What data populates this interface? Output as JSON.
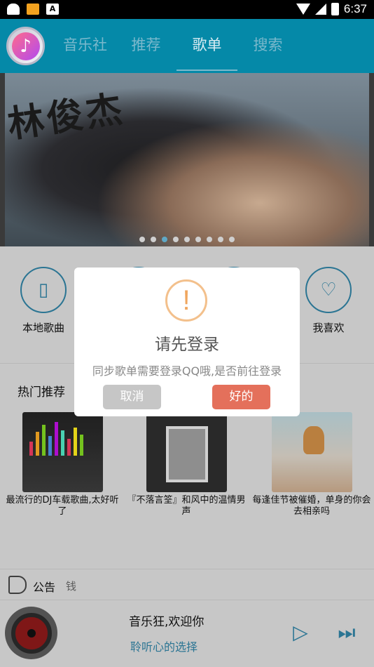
{
  "status_bar": {
    "time": "6:37",
    "icons": [
      "android-icon",
      "app-notification-icon",
      "a-icon",
      "wifi-icon",
      "signal-icon",
      "battery-icon"
    ]
  },
  "nav": {
    "tabs": [
      {
        "label": "音乐社",
        "active": false
      },
      {
        "label": "推荐",
        "active": false
      },
      {
        "label": "歌单",
        "active": true
      },
      {
        "label": "搜索",
        "active": false
      }
    ]
  },
  "banner": {
    "text": "林俊杰",
    "dots": 9,
    "active_dot": 2
  },
  "shortcuts": [
    {
      "label": "本地歌曲",
      "icon": "phone-music-icon"
    },
    {
      "label": "",
      "icon": "hidden-icon"
    },
    {
      "label": "",
      "icon": "hidden-icon"
    },
    {
      "label": "我喜欢",
      "icon": "heart-icon"
    }
  ],
  "hot": {
    "title": "热门推荐",
    "items": [
      {
        "caption": "最流行的DJ车载歌曲,太好听了"
      },
      {
        "caption": "『不落言筌』和风中的温情男声"
      },
      {
        "caption": "每逢佳节被催婚，单身的你会去相亲吗"
      }
    ]
  },
  "notice": {
    "title": "公告",
    "message": "钱"
  },
  "player": {
    "song": "音乐狂,欢迎你",
    "artist": "聆听心的选择"
  },
  "dialog": {
    "icon": "!",
    "title": "请先登录",
    "message": "同步歌单需要登录QQ哦,是否前往登录",
    "cancel": "取消",
    "ok": "好的"
  },
  "colors": {
    "nav_bg": "#0589a8",
    "accent": "#2f7fa0",
    "ok_button": "#e4705b",
    "cancel_button": "#c6c6c6"
  }
}
